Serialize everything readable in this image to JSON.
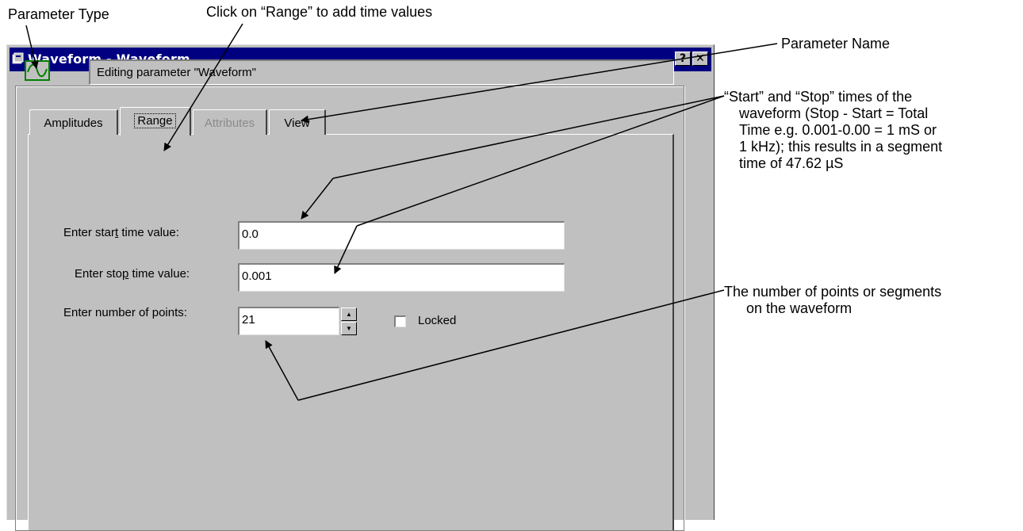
{
  "annotations": {
    "parameter_type": "Parameter Type",
    "click_range": "Click on “Range” to add time values",
    "parameter_name": "Parameter Name",
    "start_stop_lines": [
      "“Start” and “Stop” times of the",
      "waveform (Stop - Start = Total",
      "Time e.g. 0.001-0.00 = 1 mS or",
      "1 kHz); this results in a segment",
      "time of 47.62 µS"
    ],
    "num_points_lines": [
      "The number of points or segments",
      "on the waveform"
    ]
  },
  "window": {
    "title": "Waveform - Waveform",
    "help_label": "?",
    "close_label": "✕",
    "editing_label": "Editing parameter \"Waveform\""
  },
  "tabs": [
    {
      "label": "Amplitudes",
      "state": "normal"
    },
    {
      "label": "Range",
      "state": "active"
    },
    {
      "label": "Attributes",
      "state": "disabled"
    },
    {
      "label": "View",
      "state": "normal"
    }
  ],
  "range": {
    "start_label_pre": "Enter star",
    "start_label_mnemonic": "t",
    "start_label_post": " time value:",
    "start_value": "0.0",
    "stop_label_pre": "Enter sto",
    "stop_label_mnemonic": "p",
    "stop_label_post": " time value:",
    "stop_value": "0.001",
    "points_label": "Enter number of points:",
    "points_value": "21",
    "spin_up": "▲",
    "spin_down": "▼",
    "locked_label": "Locked",
    "locked_checked": false
  },
  "colors": {
    "titlebar": "#000080",
    "waveform_icon": "#008000",
    "dialog_face": "#c0c0c0"
  },
  "icons": {
    "parameter_type": "sine-wave-icon",
    "title": "window-app-icon"
  }
}
